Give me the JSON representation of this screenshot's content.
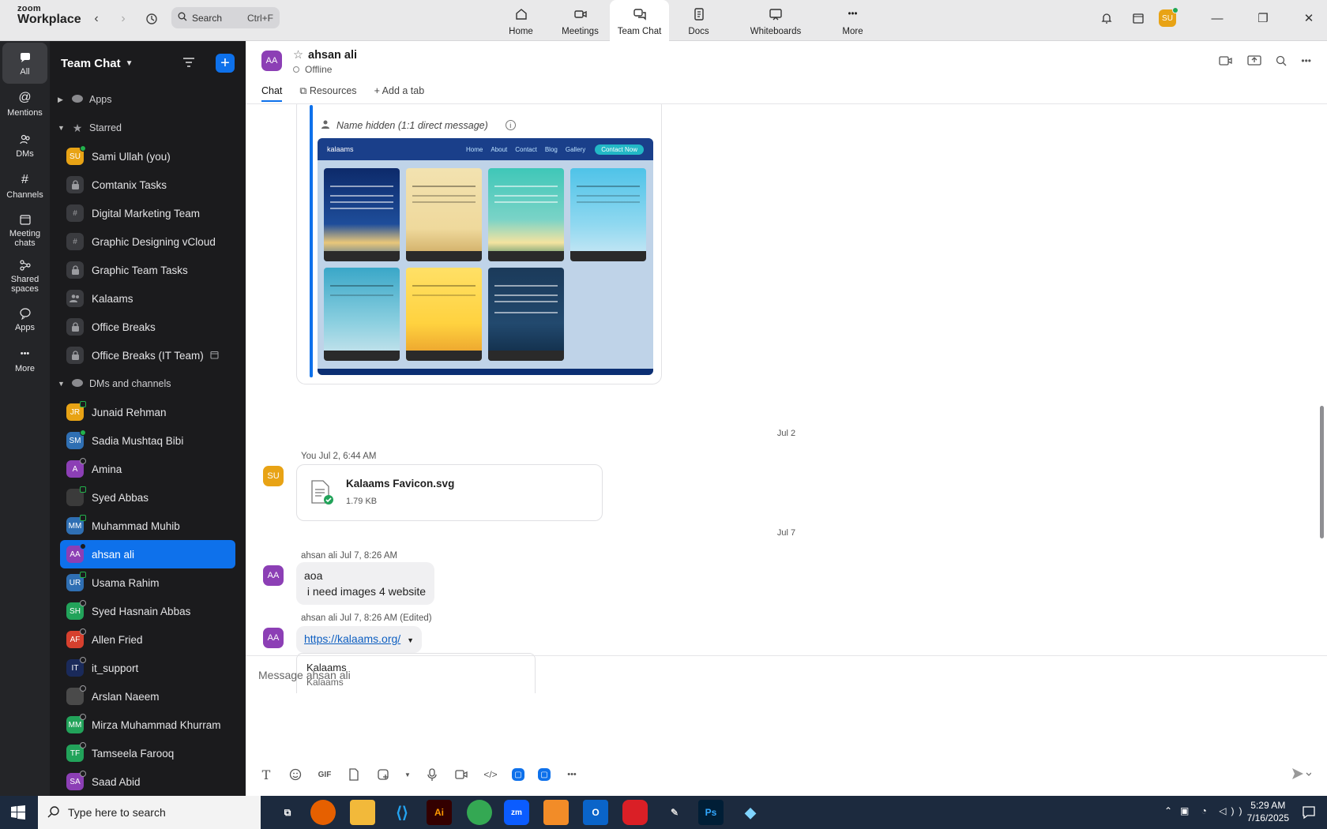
{
  "app": {
    "brand_top": "zoom",
    "brand_bottom": "Workplace"
  },
  "search": {
    "placeholder": "Search",
    "shortcut": "Ctrl+F"
  },
  "tabs": [
    {
      "label": "Home",
      "icon": "home-icon"
    },
    {
      "label": "Meetings",
      "icon": "video-camera-icon"
    },
    {
      "label": "Team Chat",
      "icon": "chat-bubbles-icon",
      "active": true
    },
    {
      "label": "Docs",
      "icon": "document-icon"
    },
    {
      "label": "Whiteboards",
      "icon": "whiteboard-icon"
    },
    {
      "label": "More",
      "icon": "more-dots-icon"
    }
  ],
  "user": {
    "initials": "SU"
  },
  "rail": [
    {
      "label": "All",
      "active": true
    },
    {
      "label": "Mentions"
    },
    {
      "label": "DMs"
    },
    {
      "label": "Channels"
    },
    {
      "label": "Meeting chats"
    },
    {
      "label": "Shared spaces"
    },
    {
      "label": "Apps"
    },
    {
      "label": "More"
    }
  ],
  "sidebar": {
    "title": "Team Chat",
    "sections": {
      "apps": "Apps",
      "starred": "Starred",
      "dms": "DMs and channels"
    },
    "starred": [
      {
        "label": "Sami Ullah (you)",
        "initials": "SU",
        "color": "#e8a315",
        "status": "on"
      },
      {
        "label": "Comtanix Tasks",
        "glyph": "lock"
      },
      {
        "label": "Digital Marketing Team",
        "glyph": "hash"
      },
      {
        "label": "Graphic Designing vCloud",
        "glyph": "hash"
      },
      {
        "label": "Graphic Team Tasks",
        "glyph": "lock"
      },
      {
        "label": "Kalaams",
        "glyph": "group"
      },
      {
        "label": "Office Breaks",
        "glyph": "lock"
      },
      {
        "label": "Office Breaks (IT Team)",
        "glyph": "lock"
      }
    ],
    "dms": [
      {
        "label": "Junaid Rehman",
        "initials": "JR",
        "color": "#e8a315",
        "status": "sq"
      },
      {
        "label": "Sadia Mushtaq Bibi",
        "initials": "SM",
        "color": "#2f6fb3",
        "status": "on"
      },
      {
        "label": "Amina",
        "initials": "A",
        "color": "#8c3fb5",
        "status": "off"
      },
      {
        "label": "Syed Abbas",
        "initials": "",
        "color": "#3b3b3b",
        "status": "sq"
      },
      {
        "label": "Muhammad Muhib",
        "initials": "MM",
        "color": "#2f6fb3",
        "status": "sq"
      },
      {
        "label": "ahsan ali",
        "initials": "AA",
        "color": "#8c3fb5",
        "status": "off",
        "selected": true
      },
      {
        "label": "Usama Rahim",
        "initials": "UR",
        "color": "#2f6fb3",
        "status": "sq"
      },
      {
        "label": "Syed Hasnain Abbas",
        "initials": "SH",
        "color": "#22a35a",
        "status": "off"
      },
      {
        "label": "Allen Fried",
        "initials": "AF",
        "color": "#d6402e",
        "status": "off"
      },
      {
        "label": "it_support",
        "initials": "IT",
        "color": "#1a2a5a",
        "status": "off"
      },
      {
        "label": "Arslan Naeem",
        "initials": "",
        "color": "#4a4a4a",
        "status": "off"
      },
      {
        "label": "Mirza Muhammad Khurram",
        "initials": "MM",
        "color": "#22a35a",
        "status": "off"
      },
      {
        "label": "Tamseela Farooq",
        "initials": "TF",
        "color": "#22a35a",
        "status": "off"
      },
      {
        "label": "Saad Abid",
        "initials": "SA",
        "color": "#8c3fb5",
        "status": "off"
      }
    ]
  },
  "chat": {
    "name": "ahsan ali",
    "initials": "AA",
    "status": "Offline",
    "tabs": [
      "Chat",
      "Resources",
      "Add a tab"
    ],
    "hidden_label": "Name hidden (1:1 direct message)",
    "preview": {
      "brand": "kalaams",
      "nav": [
        "Home",
        "About",
        "Contact",
        "Blog",
        "Gallery"
      ],
      "cta": "Contact Now"
    },
    "date1": "Jul 2",
    "msg1_meta": "You Jul 2, 6:44 AM",
    "file_name": "Kalaams Favicon.svg",
    "file_size": "1.79 KB",
    "date2": "Jul 7",
    "msg2_meta": "ahsan ali Jul 7, 8:26 AM",
    "msg2_line1": "aoa",
    "msg2_line2": " i need images 4 website",
    "msg3_meta": "ahsan ali Jul 7, 8:26 AM (Edited)",
    "msg3_link": "https://kalaams.org/",
    "linkcard_title": "Kalaams",
    "linkcard_sub": "Kalaams"
  },
  "composer": {
    "placeholder": "Message ahsan ali"
  },
  "taskbar": {
    "search": "Type here to search",
    "time": "5:29 AM",
    "date": "7/16/2025"
  }
}
